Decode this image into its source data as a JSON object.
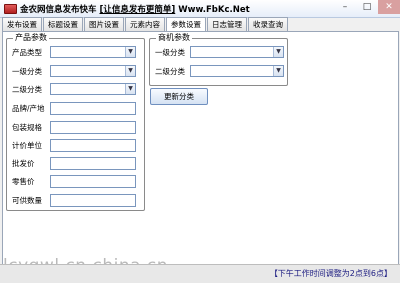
{
  "window": {
    "title_prefix": "金农网信息发布快车 ",
    "title_link": "[让信息发布更简单]",
    "title_suffix": " Www.FbKc.Net",
    "min_icon": "minimize-icon",
    "max_icon": "maximize-icon",
    "close_icon": "close-icon"
  },
  "tabs": [
    "发布设置",
    "标题设置",
    "图片设置",
    "元素内容",
    "参数设置",
    "日志管理",
    "收录查询"
  ],
  "product_params": {
    "legend": "产品参数",
    "fields": [
      {
        "label": "产品类型",
        "type": "combo",
        "value": ""
      },
      {
        "label": "一级分类",
        "type": "combo",
        "value": ""
      },
      {
        "label": "二级分类",
        "type": "combo",
        "value": ""
      },
      {
        "label": "品牌/产地",
        "type": "text",
        "value": ""
      },
      {
        "label": "包装规格",
        "type": "text",
        "value": ""
      },
      {
        "label": "计价单位",
        "type": "text",
        "value": ""
      },
      {
        "label": "批发价",
        "type": "text",
        "value": ""
      },
      {
        "label": "零售价",
        "type": "text",
        "value": ""
      },
      {
        "label": "可供数量",
        "type": "text",
        "value": ""
      }
    ]
  },
  "business_params": {
    "legend": "商机参数",
    "fields": [
      {
        "label": "一级分类",
        "type": "combo",
        "value": ""
      },
      {
        "label": "二级分类",
        "type": "combo",
        "value": ""
      }
    ]
  },
  "update_button": "更新分类",
  "watermark": "lcygwl.cn.china.cn",
  "status": "【下午工作时间调整为2点到6点】"
}
